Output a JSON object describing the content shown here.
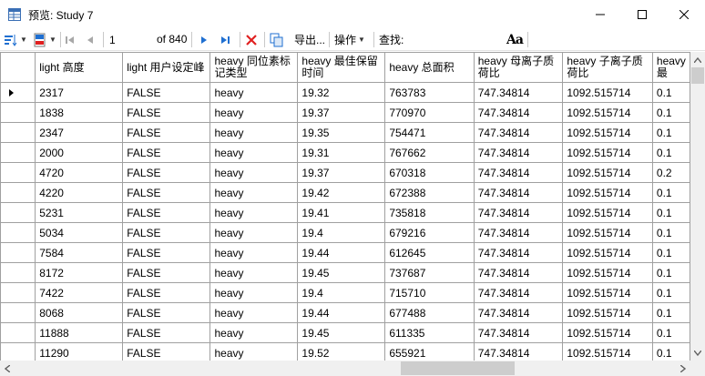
{
  "window": {
    "title": "预览: Study 7",
    "icons": {
      "app": "table-preview-icon",
      "minimize": "minimize-icon",
      "maximize": "maximize-icon",
      "close": "close-icon"
    }
  },
  "toolbar": {
    "position_value": "1",
    "of_label": "of 840",
    "export_label": "导出...",
    "actions_label": "操作",
    "find_label": "查找:",
    "font_button_label": "Aa"
  },
  "grid": {
    "columns": [
      "light 高度",
      "light 用户设定峰",
      "heavy 同位素标记类型",
      "heavy 最佳保留时间",
      "heavy 总面积",
      "heavy 母离子质荷比",
      "heavy 子离子质荷比",
      "heavy 最"
    ],
    "rows": [
      [
        "2317",
        "FALSE",
        "heavy",
        "19.32",
        "763783",
        "747.34814",
        "1092.515714",
        "0.1"
      ],
      [
        "1838",
        "FALSE",
        "heavy",
        "19.37",
        "770970",
        "747.34814",
        "1092.515714",
        "0.1"
      ],
      [
        "2347",
        "FALSE",
        "heavy",
        "19.35",
        "754471",
        "747.34814",
        "1092.515714",
        "0.1"
      ],
      [
        "2000",
        "FALSE",
        "heavy",
        "19.31",
        "767662",
        "747.34814",
        "1092.515714",
        "0.1"
      ],
      [
        "4720",
        "FALSE",
        "heavy",
        "19.37",
        "670318",
        "747.34814",
        "1092.515714",
        "0.2"
      ],
      [
        "4220",
        "FALSE",
        "heavy",
        "19.42",
        "672388",
        "747.34814",
        "1092.515714",
        "0.1"
      ],
      [
        "5231",
        "FALSE",
        "heavy",
        "19.41",
        "735818",
        "747.34814",
        "1092.515714",
        "0.1"
      ],
      [
        "5034",
        "FALSE",
        "heavy",
        "19.4",
        "679216",
        "747.34814",
        "1092.515714",
        "0.1"
      ],
      [
        "7584",
        "FALSE",
        "heavy",
        "19.44",
        "612645",
        "747.34814",
        "1092.515714",
        "0.1"
      ],
      [
        "8172",
        "FALSE",
        "heavy",
        "19.45",
        "737687",
        "747.34814",
        "1092.515714",
        "0.1"
      ],
      [
        "7422",
        "FALSE",
        "heavy",
        "19.4",
        "715710",
        "747.34814",
        "1092.515714",
        "0.1"
      ],
      [
        "8068",
        "FALSE",
        "heavy",
        "19.44",
        "677488",
        "747.34814",
        "1092.515714",
        "0.1"
      ],
      [
        "11888",
        "FALSE",
        "heavy",
        "19.45",
        "611335",
        "747.34814",
        "1092.515714",
        "0.1"
      ],
      [
        "11290",
        "FALSE",
        "heavy",
        "19.52",
        "655921",
        "747.34814",
        "1092.515714",
        "0.1"
      ]
    ]
  },
  "colors": {
    "accent_blue": "#1f6fd1",
    "delete_red": "#e02020",
    "grid_line": "#a0a0a0"
  }
}
